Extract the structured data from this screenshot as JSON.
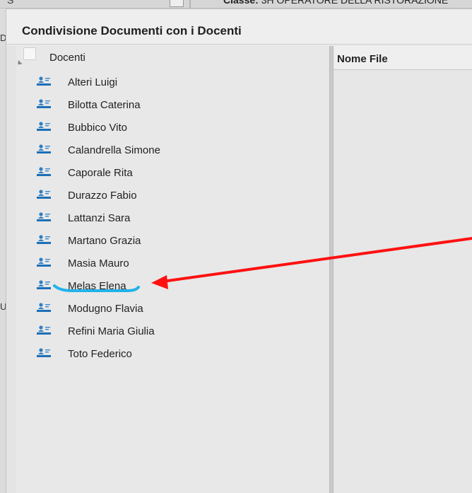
{
  "background": {
    "left_fragment": "S",
    "class_label": "Classe:",
    "class_value": "3H OPERATORE DELLA RISTORAZIONE",
    "side_letter_d": "D",
    "side_letter_u": "U"
  },
  "dialog": {
    "title": "Condivisione Documenti con i Docenti",
    "tree": {
      "root_label": "Docenti",
      "items": [
        {
          "label": "Alteri Luigi",
          "icon": "user-card-icon"
        },
        {
          "label": "Bilotta Caterina",
          "icon": "user-card-icon"
        },
        {
          "label": "Bubbico Vito",
          "icon": "user-card-icon"
        },
        {
          "label": "Calandrella Simone",
          "icon": "user-card-icon"
        },
        {
          "label": "Caporale Rita",
          "icon": "user-card-icon"
        },
        {
          "label": "Durazzo Fabio",
          "icon": "user-card-icon"
        },
        {
          "label": "Lattanzi Sara",
          "icon": "user-card-icon"
        },
        {
          "label": "Martano Grazia",
          "icon": "user-card-icon"
        },
        {
          "label": "Masia Mauro",
          "icon": "user-card-icon"
        },
        {
          "label": "Melas Elena",
          "icon": "user-card-icon"
        },
        {
          "label": "Modugno Flavia",
          "icon": "user-card-icon"
        },
        {
          "label": "Refini Maria Giulia",
          "icon": "user-card-icon"
        },
        {
          "label": "Toto Federico",
          "icon": "user-card-icon"
        }
      ]
    },
    "files": {
      "column_header": "Nome File"
    }
  },
  "annotations": {
    "arrow_color": "#ff1111",
    "underline_color": "#21b2ea"
  }
}
